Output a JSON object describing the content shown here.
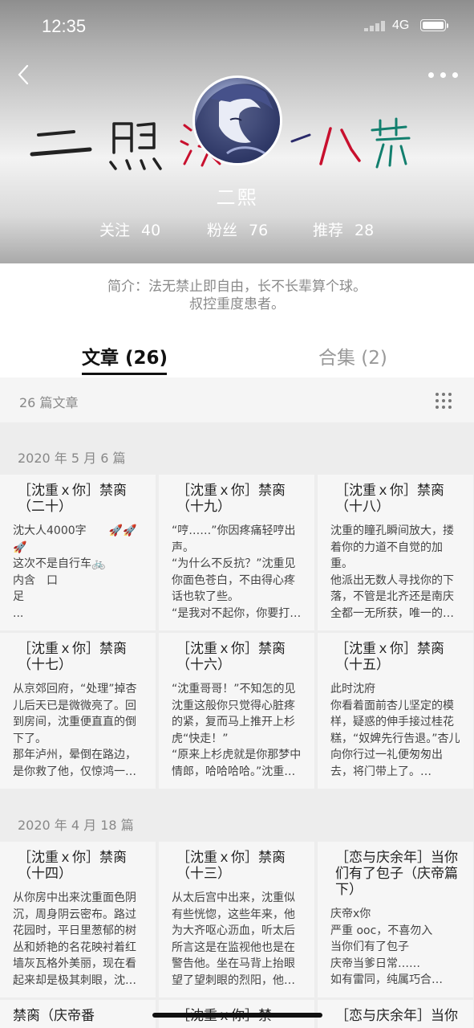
{
  "status_bar": {
    "time": "12:35",
    "network": "4G"
  },
  "profile": {
    "banner_text": "二熙",
    "username": "二熙",
    "stats": [
      {
        "label": "关注",
        "value": "40"
      },
      {
        "label": "粉丝",
        "value": "76"
      },
      {
        "label": "推荐",
        "value": "28"
      }
    ],
    "bio_line1": "简介：法无禁止即自由，长不长辈算个球。",
    "bio_line2": "叔控重度患者。"
  },
  "tabs": [
    {
      "label": "文章 (26)",
      "active": true
    },
    {
      "label": "合集 (2)",
      "active": false
    }
  ],
  "article_count": "26 篇文章",
  "sections": [
    {
      "title": "2020 年 5 月    6 篇",
      "cards": [
        {
          "title": "［沈重ｘ你］禁脔（二十）",
          "body": "沈大人4000字　　🚀🚀🚀\n这次不是自行车🚲\n内含　口\n足\n..."
        },
        {
          "title": "［沈重ｘ你］禁脔（十九）",
          "body": "“哼……”你因疼痛轻哼出声。\n“为什么不反抗？”沈重见你面色苍白，不由得心疼话也软了些。\n“是我对不起你，你要打…"
        },
        {
          "title": "［沈重ｘ你］禁脔（十八）",
          "body": "沈重的瞳孔瞬间放大，搂着你的力道不自觉的加重。\n他派出无数人寻找你的下落，不管是北齐还是南庆全都一无所获，唯一的…"
        },
        {
          "title": "［沈重ｘ你］禁脔（十七）",
          "body": "从京郊回府，“处理”掉杏儿后天已是微微亮了。回到房间，沈重便直直的倒下了。\n那年泸州，晕倒在路边，是你救了他，仅惊鸿一…"
        },
        {
          "title": "［沈重ｘ你］禁脔（十六）",
          "body": "“沈重哥哥！”不知怎的见沈重这般你只觉得心脏疼的紧，复而马上推开上杉虎“快走！”\n“原来上杉虎就是你那梦中情郎，哈哈哈哈。”沈重…"
        },
        {
          "title": "［沈重ｘ你］禁脔（十五）",
          "body": "此时沈府\n你看着面前杏儿坚定的模样，疑惑的伸手接过桂花糕，“奴婢先行告退。”杏儿向你行过一礼便匆匆出去，将门带上了。…"
        }
      ]
    },
    {
      "title": "2020 年 4 月    18 篇",
      "cards": [
        {
          "title": "［沈重ｘ你］禁脔（十四）",
          "body": "从你房中出来沈重面色阴沉，周身阴云密布。路过花园时，平日里葱郁的树丛和娇艳的名花映衬着红墙灰瓦格外美丽，现在看起来却是极其刺眼，沈…"
        },
        {
          "title": "［沈重ｘ你］禁脔（十三）",
          "body": "从太后宫中出来，沈重似有些恍惚，这些年来，他为大齐呕心沥血，听太后所言这是在监视他也是在警告他。坐在马背上抬眼望了望刺眼的烈阳，他…"
        },
        {
          "title": "［恋与庆余年］当你们有了包子（庆帝篇下）",
          "body": "庆帝x你\n严重 ooc，不喜勿入\n当你们有了包子\n庆帝当爹日常……\n如有雷同，纯属巧合…"
        },
        {
          "title": "禁脔（庆帝番",
          "body": ""
        },
        {
          "title": "［沈重ｘ你］禁",
          "body": ""
        },
        {
          "title": "［恋与庆余年］当你",
          "body": ""
        }
      ]
    }
  ]
}
